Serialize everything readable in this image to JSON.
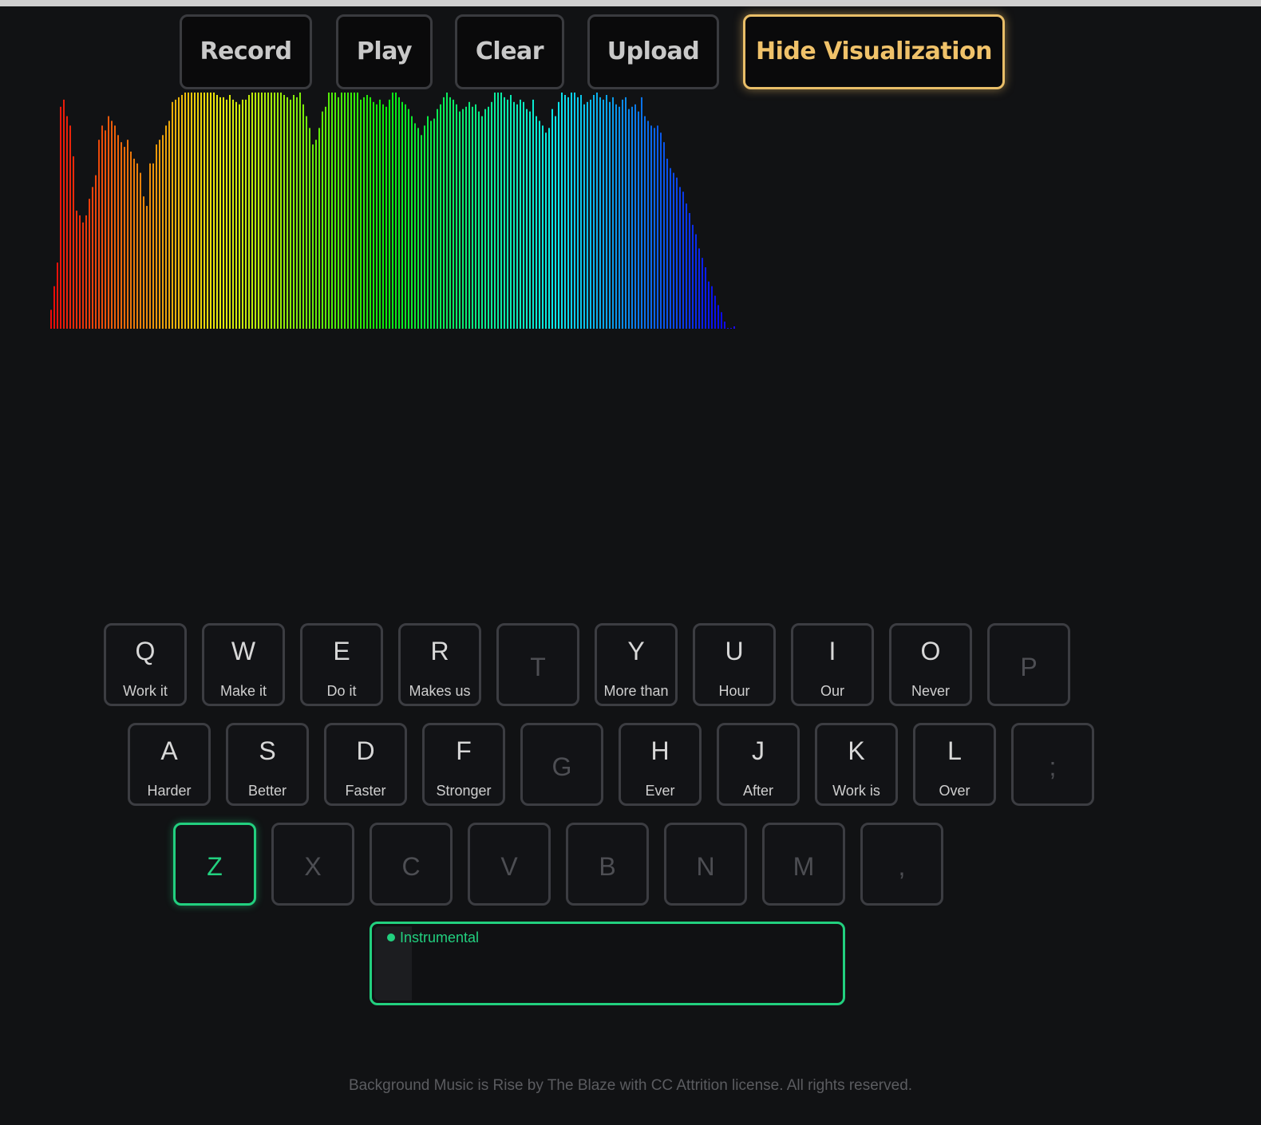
{
  "controls": {
    "record": "Record",
    "play": "Play",
    "clear": "Clear",
    "upload": "Upload",
    "hide_visualization": "Hide Visualization"
  },
  "colors": {
    "background": "#111214",
    "accent_gold": "#e9be68",
    "accent_green": "#22d07f",
    "key_border": "#3c3d42"
  },
  "visualizer": {
    "bars": [
      0.08,
      0.18,
      0.28,
      0.94,
      0.97,
      0.9,
      0.86,
      0.73,
      0.5,
      0.48,
      0.45,
      0.48,
      0.55,
      0.6,
      0.65,
      0.8,
      0.86,
      0.84,
      0.9,
      0.88,
      0.86,
      0.82,
      0.79,
      0.77,
      0.8,
      0.75,
      0.72,
      0.7,
      0.66,
      0.56,
      0.52,
      0.7,
      0.7,
      0.78,
      0.8,
      0.82,
      0.86,
      0.88,
      0.96,
      0.97,
      0.98,
      0.99,
      1.0,
      1.0,
      1.0,
      1.0,
      1.0,
      1.0,
      1.0,
      1.0,
      1.0,
      1.0,
      0.99,
      0.98,
      0.98,
      0.97,
      0.99,
      0.97,
      0.96,
      0.95,
      0.97,
      0.97,
      0.99,
      1.0,
      1.0,
      1.0,
      1.0,
      1.0,
      1.0,
      1.0,
      1.0,
      1.0,
      1.0,
      0.99,
      0.98,
      0.97,
      0.99,
      0.98,
      1.0,
      0.95,
      0.9,
      0.85,
      0.78,
      0.8,
      0.85,
      0.92,
      0.94,
      1.0,
      1.0,
      1.0,
      0.98,
      1.0,
      1.0,
      1.0,
      1.0,
      1.0,
      1.0,
      0.97,
      0.98,
      0.99,
      0.98,
      0.96,
      0.95,
      0.97,
      0.95,
      0.94,
      0.97,
      1.0,
      1.0,
      0.98,
      0.96,
      0.95,
      0.93,
      0.9,
      0.87,
      0.85,
      0.82,
      0.86,
      0.9,
      0.88,
      0.89,
      0.93,
      0.95,
      0.98,
      1.0,
      0.98,
      0.97,
      0.95,
      0.92,
      0.93,
      0.94,
      0.96,
      0.94,
      0.95,
      0.92,
      0.9,
      0.93,
      0.94,
      0.96,
      1.0,
      1.0,
      1.0,
      0.98,
      0.97,
      0.99,
      0.96,
      0.95,
      0.97,
      0.96,
      0.93,
      0.92,
      0.97,
      0.9,
      0.88,
      0.86,
      0.83,
      0.85,
      0.93,
      0.9,
      0.96,
      1.0,
      0.99,
      0.98,
      1.0,
      1.0,
      0.98,
      0.99,
      0.95,
      0.96,
      0.97,
      0.99,
      1.0,
      0.98,
      0.97,
      0.99,
      0.96,
      0.98,
      0.95,
      0.94,
      0.97,
      0.98,
      0.93,
      0.94,
      0.95,
      0.92,
      0.98,
      0.9,
      0.88,
      0.86,
      0.85,
      0.86,
      0.83,
      0.79,
      0.72,
      0.68,
      0.66,
      0.64,
      0.6,
      0.58,
      0.53,
      0.49,
      0.44,
      0.4,
      0.34,
      0.3,
      0.26,
      0.2,
      0.18,
      0.14,
      0.1,
      0.07,
      0.03,
      0.0,
      0.0,
      0.01
    ]
  },
  "keyboard": {
    "row1": [
      {
        "letter": "Q",
        "word": "Work it"
      },
      {
        "letter": "W",
        "word": "Make it"
      },
      {
        "letter": "E",
        "word": "Do it"
      },
      {
        "letter": "R",
        "word": "Makes us"
      },
      {
        "letter": "T",
        "word": ""
      },
      {
        "letter": "Y",
        "word": "More than"
      },
      {
        "letter": "U",
        "word": "Hour"
      },
      {
        "letter": "I",
        "word": "Our"
      },
      {
        "letter": "O",
        "word": "Never"
      },
      {
        "letter": "P",
        "word": ""
      }
    ],
    "row2": [
      {
        "letter": "A",
        "word": "Harder"
      },
      {
        "letter": "S",
        "word": "Better"
      },
      {
        "letter": "D",
        "word": "Faster"
      },
      {
        "letter": "F",
        "word": "Stronger"
      },
      {
        "letter": "G",
        "word": ""
      },
      {
        "letter": "H",
        "word": "Ever"
      },
      {
        "letter": "J",
        "word": "After"
      },
      {
        "letter": "K",
        "word": "Work is"
      },
      {
        "letter": "L",
        "word": "Over"
      },
      {
        "letter": ";",
        "word": ""
      }
    ],
    "row3": [
      {
        "letter": "Z",
        "word": "",
        "active": true
      },
      {
        "letter": "X",
        "word": ""
      },
      {
        "letter": "C",
        "word": ""
      },
      {
        "letter": "V",
        "word": ""
      },
      {
        "letter": "B",
        "word": ""
      },
      {
        "letter": "N",
        "word": ""
      },
      {
        "letter": "M",
        "word": ""
      },
      {
        "letter": ",",
        "word": ""
      }
    ]
  },
  "track": {
    "label": "Instrumental",
    "progress": 0.08
  },
  "footer": {
    "text": "Background Music is Rise by The Blaze with CC Attrition license. All rights reserved."
  }
}
